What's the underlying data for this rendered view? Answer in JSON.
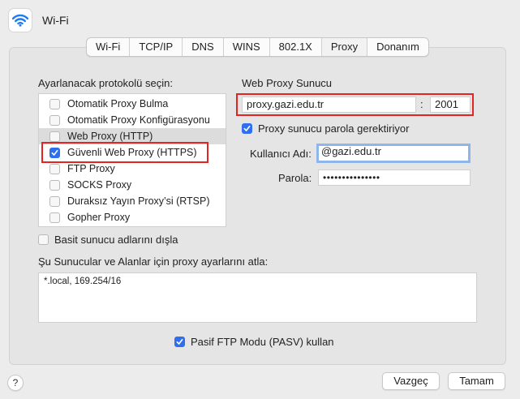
{
  "window": {
    "title": "Wi-Fi",
    "icon": "wifi-icon"
  },
  "tabs": [
    {
      "label": "Wi-Fi"
    },
    {
      "label": "TCP/IP"
    },
    {
      "label": "DNS"
    },
    {
      "label": "WINS"
    },
    {
      "label": "802.1X"
    },
    {
      "label": "Proxy",
      "active": true
    },
    {
      "label": "Donanım"
    }
  ],
  "protocols": {
    "heading": "Ayarlanacak protokolü seçin:",
    "items": [
      {
        "label": "Otomatik Proxy Bulma",
        "checked": false
      },
      {
        "label": "Otomatik Proxy Konfigürasyonu",
        "checked": false
      },
      {
        "label": "Web Proxy (HTTP)",
        "checked": false,
        "selected": true
      },
      {
        "label": "Güvenli Web Proxy (HTTPS)",
        "checked": true
      },
      {
        "label": "FTP Proxy",
        "checked": false
      },
      {
        "label": "SOCKS Proxy",
        "checked": false
      },
      {
        "label": "Duraksız Yayın Proxy’si (RTSP)",
        "checked": false
      },
      {
        "label": "Gopher Proxy",
        "checked": false
      }
    ]
  },
  "proxy_server": {
    "heading": "Web Proxy Sunucu",
    "server": "proxy.gazi.edu.tr",
    "separator": ":",
    "port": "2001",
    "requires_password_label": "Proxy sunucu parola gerektiriyor",
    "requires_password": true,
    "username_label": "Kullanıcı Adı:",
    "username": "@gazi.edu.tr",
    "password_label": "Parola:",
    "password": "•••••••••••••••"
  },
  "exclude_simple_hostnames": {
    "label": "Basit sunucu adlarını dışla",
    "checked": false
  },
  "bypass": {
    "label": "Şu Sunucular ve Alanlar için proxy ayarlarını atla:",
    "value": "*.local, 169.254/16"
  },
  "passive_ftp": {
    "label": "Pasif FTP Modu (PASV) kullan",
    "checked": true
  },
  "footer": {
    "help_label": "?",
    "cancel_label": "Vazgeç",
    "ok_label": "Tamam"
  },
  "colors": {
    "accent": "#2e6ff0",
    "highlight_box": "#e42323",
    "focus_ring": "#8fb6ea"
  }
}
